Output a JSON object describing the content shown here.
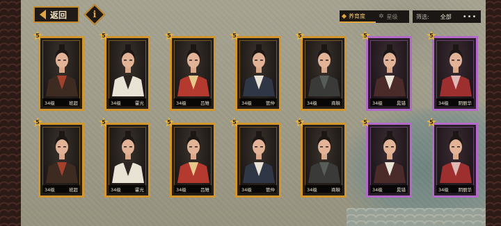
{
  "topbar": {
    "back_label": "返回",
    "info_glyph": "i",
    "sort_tabs": [
      {
        "label": "养育度",
        "active": true
      },
      {
        "label": "星级",
        "active": false
      }
    ],
    "filter": {
      "label": "筛选:",
      "value": "全部",
      "more": "•••"
    }
  },
  "colors": {
    "gold_frame": "#d3962d",
    "purple_frame": "#b36ac9",
    "accent": "#e0a53d"
  },
  "heroes": [
    {
      "name": "班超",
      "level": "34级",
      "stars": "5",
      "frame": "gold",
      "robe": "#3d2b22",
      "trim": "#a3412c"
    },
    {
      "name": "霍光",
      "level": "34级",
      "stars": "5",
      "frame": "gold",
      "robe": "#e9e3d6",
      "trim": "#2d2522"
    },
    {
      "name": "吕雉",
      "level": "34级",
      "stars": "5",
      "frame": "gold",
      "robe": "#b4392e",
      "trim": "#e6c88a"
    },
    {
      "name": "管仲",
      "level": "34级",
      "stars": "5",
      "frame": "gold",
      "robe": "#2f3747",
      "trim": "#e9e3d6"
    },
    {
      "name": "商鞅",
      "level": "34级",
      "stars": "5",
      "frame": "gold",
      "robe": "#3a3a38",
      "trim": "#585e57"
    },
    {
      "name": "晁错",
      "level": "34级",
      "stars": "5",
      "frame": "purple",
      "robe": "#4b2a2a",
      "trim": "#e9e3d6"
    },
    {
      "name": "阴丽华",
      "level": "34级",
      "stars": "5",
      "frame": "purple",
      "robe": "#9e2f2f",
      "trim": "#e0b9b6"
    },
    {
      "name": "班超",
      "level": "34级",
      "stars": "5",
      "frame": "gold",
      "robe": "#3d2b22",
      "trim": "#a3412c"
    },
    {
      "name": "霍光",
      "level": "34级",
      "stars": "5",
      "frame": "gold",
      "robe": "#e9e3d6",
      "trim": "#2d2522"
    },
    {
      "name": "吕雉",
      "level": "34级",
      "stars": "5",
      "frame": "gold",
      "robe": "#b4392e",
      "trim": "#e6c88a"
    },
    {
      "name": "管仲",
      "level": "34级",
      "stars": "5",
      "frame": "gold",
      "robe": "#2f3747",
      "trim": "#e9e3d6"
    },
    {
      "name": "商鞅",
      "level": "34级",
      "stars": "5",
      "frame": "gold",
      "robe": "#3a3a38",
      "trim": "#585e57"
    },
    {
      "name": "晁错",
      "level": "34级",
      "stars": "5",
      "frame": "purple",
      "robe": "#4b2a2a",
      "trim": "#e9e3d6"
    },
    {
      "name": "阴丽华",
      "level": "34级",
      "stars": "5",
      "frame": "purple",
      "robe": "#9e2f2f",
      "trim": "#e0b9b6"
    }
  ]
}
